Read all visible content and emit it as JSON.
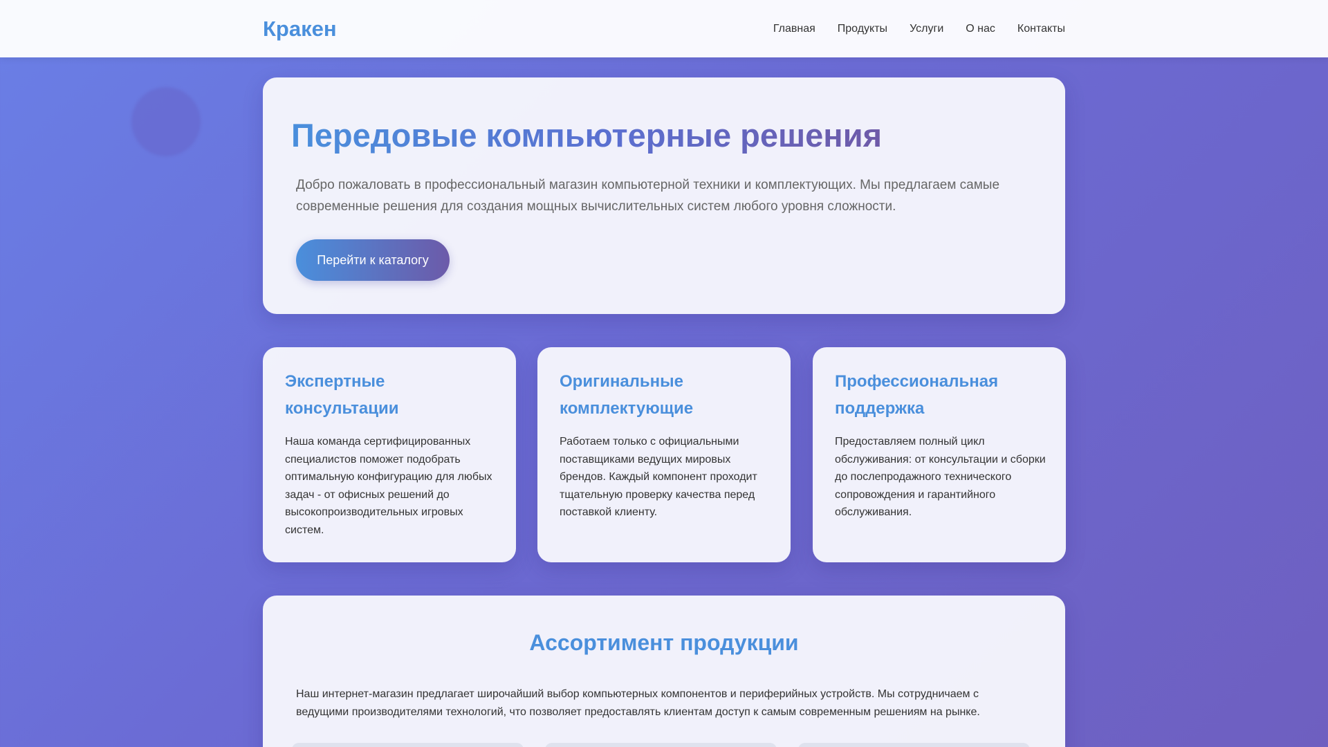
{
  "nav": {
    "logo": "Кракен",
    "links": [
      "Главная",
      "Продукты",
      "Услуги",
      "О нас",
      "Контакты"
    ]
  },
  "hero": {
    "title": "Передовые компьютерные решения",
    "text": "Добро пожаловать в профессиональный магазин компьютерной техники и комплектующих. Мы предлагаем самые современные решения для создания мощных вычислительных систем любого уровня сложности.",
    "button": "Перейти к каталогу"
  },
  "features": [
    {
      "title": "Экспертные консультации",
      "text": "Наша команда сертифицированных специалистов поможет подобрать оптимальную конфигурацию для любых задач - от офисных решений до высокопроизводительных игровых систем."
    },
    {
      "title": "Оригинальные комплектующие",
      "text": "Работаем только с официальными поставщиками ведущих мировых брендов. Каждый компонент проходит тщательную проверку качества перед поставкой клиенту."
    },
    {
      "title": "Профессиональная поддержка",
      "text": "Предоставляем полный цикл обслуживания: от консультации и сборки до послепродажного технического сопровождения и гарантийного обслуживания."
    }
  ],
  "assortment": {
    "title": "Ассортимент продукции",
    "text": "Наш интернет-магазин предлагает широчайший выбор компьютерных компонентов и периферийных устройств. Мы сотрудничаем с ведущими производителями технологий, что позволяет предоставлять клиентам доступ к самым современным решениям на рынке."
  },
  "colors": {
    "accent": "#4a8fdc",
    "accent_end": "#6c5aa9",
    "background": "#6b6bd4"
  }
}
